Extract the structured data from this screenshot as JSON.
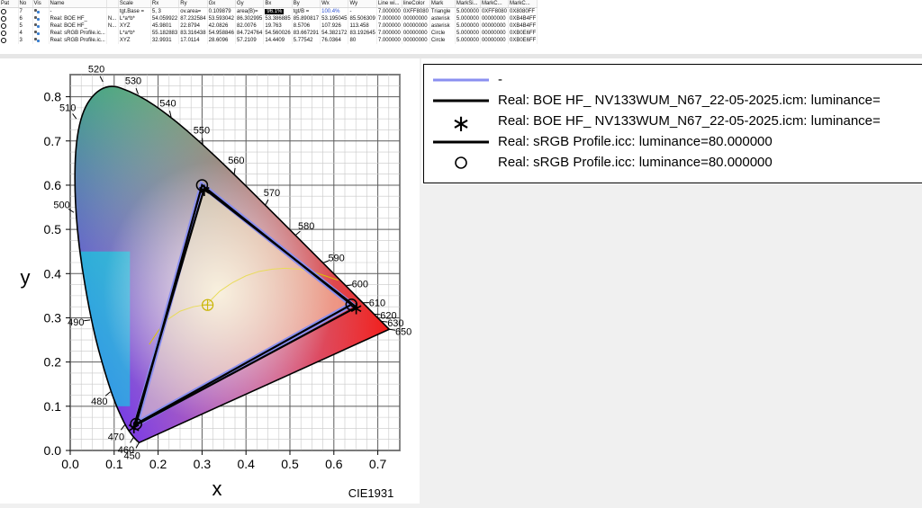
{
  "table": {
    "headers": [
      "Pat",
      "No",
      "Vis",
      "Name",
      "",
      "Scale",
      "Rx",
      "Ry",
      "Gx",
      "Gy",
      "Bx",
      "By",
      "Wx",
      "Wy",
      "Line wi...",
      "lineColor",
      "Mark",
      "MarkSi...",
      "MarkC...",
      "MarkC..."
    ],
    "rows": [
      {
        "no": "7",
        "name": "-",
        "name2": "",
        "scale": "tgt.Base =",
        "rx": "5, 3",
        "ry": "ov.area=",
        "gx": "0.109879",
        "gy": "area(B)=",
        "bx": "96.1%",
        "by": "tgt/B =",
        "wx": "100.4%",
        "wy": "-",
        "lw": "7.000000",
        "lc": "0XFF8080",
        "mark": "Triangle",
        "ms": "5.000000",
        "mc1": "0XFF8080",
        "mc2": "0X8080FF"
      },
      {
        "no": "6",
        "name": "Real: BOE HF_",
        "name2": "N...",
        "scale": "L*a*b*",
        "rx": "54.059922",
        "ry": "87.232584",
        "gx": "53.593042",
        "gy": "86.302995",
        "bx": "53.386885",
        "by": "85.890817",
        "wx": "53.195045",
        "wy": "85.506309",
        "lw": "7.000000",
        "lc": "00000000",
        "mark": "asterisk",
        "ms": "5.000000",
        "mc1": "00000000",
        "mc2": "0XB4B4FF"
      },
      {
        "no": "5",
        "name": "Real: BOE HF_",
        "name2": "N...",
        "scale": "XYZ",
        "rx": "45.9801",
        "ry": "22.8794",
        "gx": "42.0826",
        "gy": "82.0076",
        "bx": "19.763",
        "by": "8.5706",
        "wx": "107.926",
        "wy": "113.458",
        "lw": "7.000000",
        "lc": "00000000",
        "mark": "asterisk",
        "ms": "5.000000",
        "mc1": "00000000",
        "mc2": "0XB4B4FF"
      },
      {
        "no": "4",
        "name": "Real: sRGB Profile.ic...",
        "name2": "",
        "scale": "L*a*b*",
        "rx": "55.182883",
        "ry": "83.316438",
        "gx": "54.958846",
        "gy": "84.724764",
        "bx": "54.560026",
        "by": "83.667291",
        "wx": "54.382172",
        "wy": "83.192645",
        "lw": "7.000000",
        "lc": "00000000",
        "mark": "Circle",
        "ms": "5.000000",
        "mc1": "00000000",
        "mc2": "0XB0E6FF"
      },
      {
        "no": "3",
        "name": "Real: sRGB Profile.ic...",
        "name2": "",
        "scale": "XYZ",
        "rx": "32.9931",
        "ry": "17.0114",
        "gx": "28.6096",
        "gy": "57.2109",
        "bx": "14.4409",
        "by": "5.77542",
        "wx": "76.0364",
        "wy": "80",
        "lw": "7.000000",
        "lc": "00000000",
        "mark": "Circle",
        "ms": "5.000000",
        "mc1": "00000000",
        "mc2": "0XB0E6FF"
      }
    ]
  },
  "legend": [
    {
      "label": "-",
      "symbol": "line",
      "color": "#8a8ff0"
    },
    {
      "label": "Real: BOE HF_      NV133WUM_N67_22-05-2025.icm: luminance=",
      "symbol": "line",
      "color": "#000000"
    },
    {
      "label": "Real: BOE HF_      NV133WUM_N67_22-05-2025.icm: luminance=",
      "symbol": "asterisk",
      "color": "#000000"
    },
    {
      "label": "Real: sRGB Profile.icc: luminance=80.000000",
      "symbol": "line",
      "color": "#000000"
    },
    {
      "label": "Real: sRGB Profile.icc: luminance=80.000000",
      "symbol": "circle",
      "color": "#000000"
    }
  ],
  "chart_data": {
    "type": "scatter",
    "chart_kind": "CIE 1931 chromaticity diagram",
    "xlabel": "x",
    "ylabel": "y",
    "watermark": "CIE1931",
    "xlim": [
      0,
      0.75
    ],
    "ylim": [
      0,
      0.85
    ],
    "x_ticks": [
      "0.0",
      "0.1",
      "0.2",
      "0.3",
      "0.4",
      "0.5",
      "0.6",
      "0.7"
    ],
    "y_ticks": [
      "0.0",
      "0.1",
      "0.2",
      "0.3",
      "0.4",
      "0.5",
      "0.6",
      "0.7",
      "0.8"
    ],
    "grid": true,
    "spectral_locus": [
      {
        "nm": "450",
        "x": 0.1566,
        "y": 0.0177
      },
      {
        "nm": "460",
        "x": 0.144,
        "y": 0.0297
      },
      {
        "nm": "470",
        "x": 0.1241,
        "y": 0.0578
      },
      {
        "nm": "480",
        "x": 0.0913,
        "y": 0.1327
      },
      {
        "nm": "490",
        "x": 0.0454,
        "y": 0.295
      },
      {
        "nm": "500",
        "x": 0.0082,
        "y": 0.5384
      },
      {
        "nm": "510",
        "x": 0.0139,
        "y": 0.7502
      },
      {
        "nm": "520",
        "x": 0.0743,
        "y": 0.8338
      },
      {
        "nm": "530",
        "x": 0.1547,
        "y": 0.8059
      },
      {
        "nm": "540",
        "x": 0.2296,
        "y": 0.7543
      },
      {
        "nm": "550",
        "x": 0.3016,
        "y": 0.6923
      },
      {
        "nm": "560",
        "x": 0.3731,
        "y": 0.6245
      },
      {
        "nm": "570",
        "x": 0.4441,
        "y": 0.5547
      },
      {
        "nm": "580",
        "x": 0.5125,
        "y": 0.4866
      },
      {
        "nm": "590",
        "x": 0.5752,
        "y": 0.4242
      },
      {
        "nm": "600",
        "x": 0.627,
        "y": 0.3725
      },
      {
        "nm": "610",
        "x": 0.6658,
        "y": 0.334
      },
      {
        "nm": "620",
        "x": 0.6915,
        "y": 0.3083
      },
      {
        "nm": "630",
        "x": 0.7079,
        "y": 0.292
      },
      {
        "nm": "650",
        "x": 0.726,
        "y": 0.274
      }
    ],
    "series": [
      {
        "name": "-",
        "kind": "triangle",
        "color": "#8a8ff0",
        "points": [
          [
            0.64,
            0.33
          ],
          [
            0.3,
            0.6
          ],
          [
            0.15,
            0.06
          ]
        ]
      },
      {
        "name": "Real: BOE HF_      NV133WUM_N67_22-05-2025.icm: luminance=",
        "kind": "triangle",
        "marker": "asterisk",
        "color": "#000000",
        "points": [
          [
            0.651,
            0.324
          ],
          [
            0.305,
            0.592
          ],
          [
            0.145,
            0.055
          ]
        ]
      },
      {
        "name": "Real: sRGB Profile.icc: luminance=80.000000",
        "kind": "triangle",
        "marker": "circle",
        "color": "#000000",
        "points": [
          [
            0.64,
            0.33
          ],
          [
            0.3,
            0.6
          ],
          [
            0.15,
            0.06
          ]
        ]
      }
    ],
    "white_point": {
      "x": 0.3127,
      "y": 0.329
    },
    "planckian_locus": [
      [
        0.18,
        0.24
      ],
      [
        0.2,
        0.27
      ],
      [
        0.22,
        0.295
      ],
      [
        0.25,
        0.315
      ],
      [
        0.28,
        0.325
      ],
      [
        0.31,
        0.33
      ],
      [
        0.34,
        0.36
      ],
      [
        0.37,
        0.38
      ],
      [
        0.4,
        0.395
      ],
      [
        0.43,
        0.405
      ],
      [
        0.46,
        0.41
      ],
      [
        0.49,
        0.412
      ],
      [
        0.52,
        0.41
      ],
      [
        0.55,
        0.405
      ],
      [
        0.58,
        0.395
      ],
      [
        0.61,
        0.385
      ]
    ]
  }
}
